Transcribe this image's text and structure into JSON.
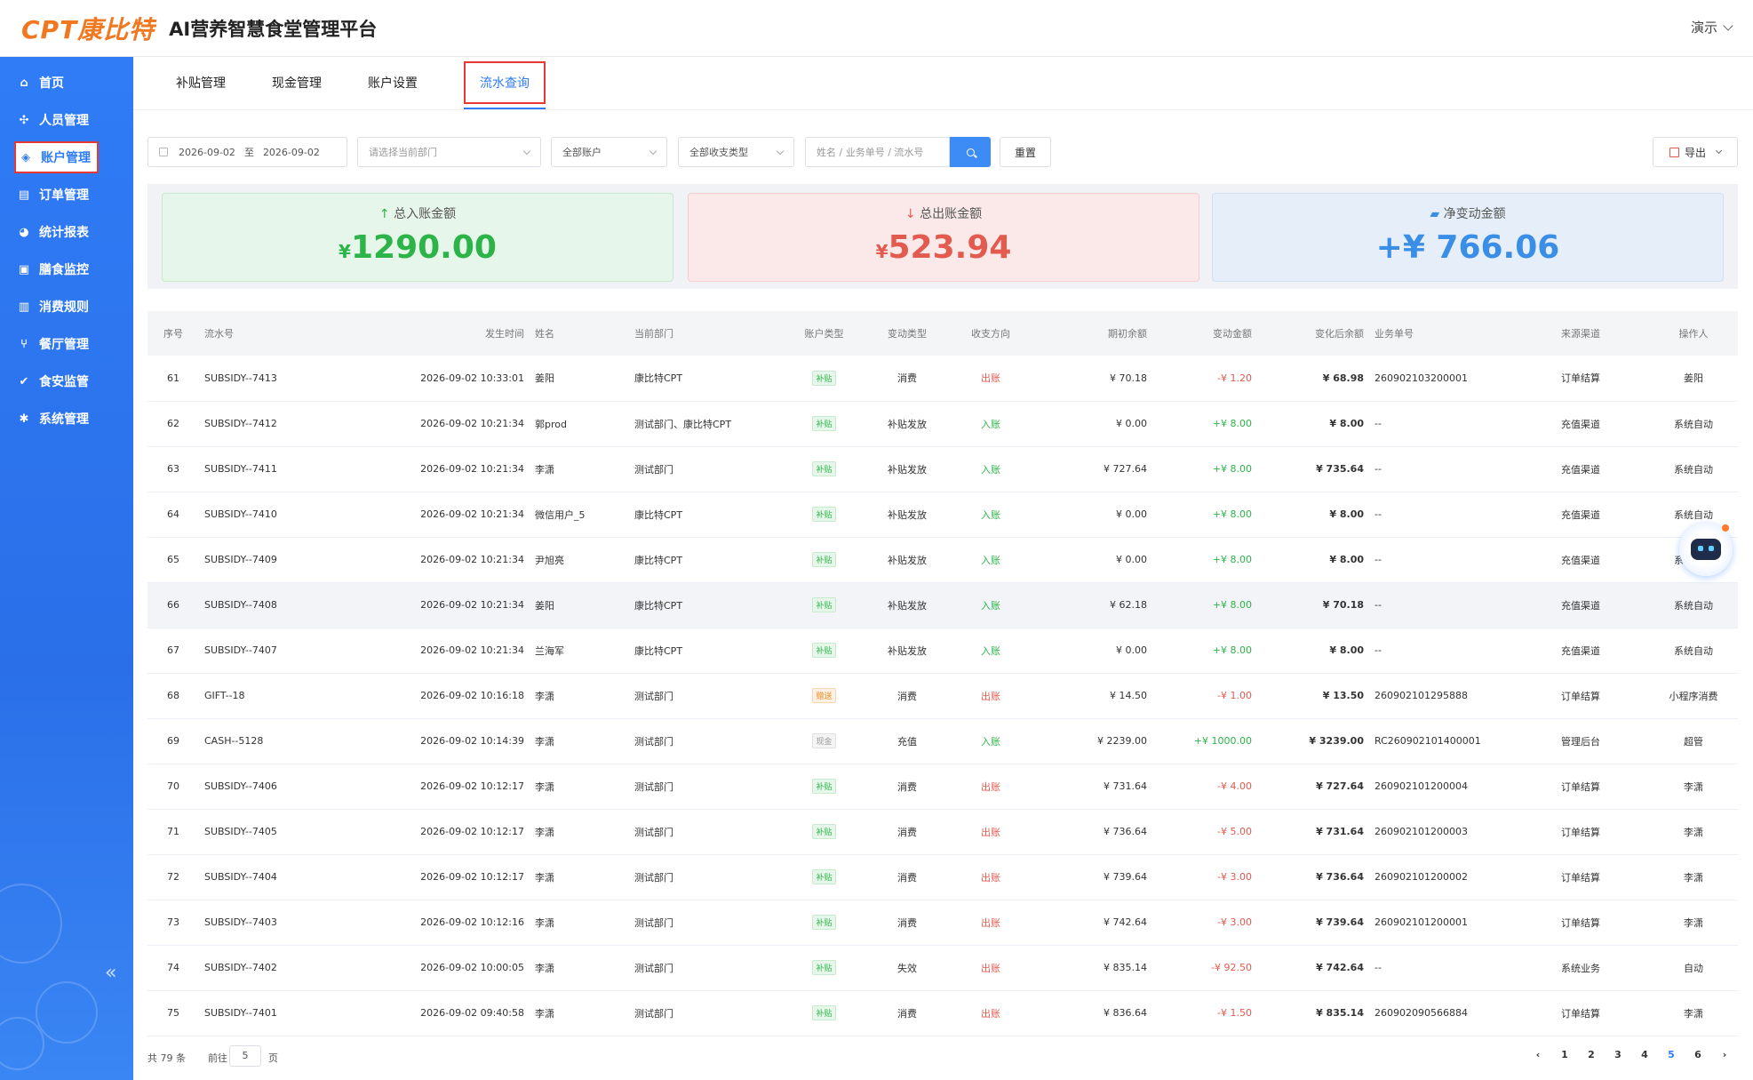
{
  "header": {
    "logo_text": "CPT康比特",
    "title": "AI营养智慧食堂管理平台",
    "user_label": "演示"
  },
  "sidebar": {
    "items": [
      {
        "label": "首页",
        "icon": "home-icon"
      },
      {
        "label": "人员管理",
        "icon": "people-icon"
      },
      {
        "label": "账户管理",
        "icon": "account-icon",
        "active": true
      },
      {
        "label": "订单管理",
        "icon": "order-icon"
      },
      {
        "label": "统计报表",
        "icon": "pie-chart-icon"
      },
      {
        "label": "膳食监控",
        "icon": "monitor-icon"
      },
      {
        "label": "消费规则",
        "icon": "bar-chart-icon"
      },
      {
        "label": "餐厅管理",
        "icon": "fork-knife-icon"
      },
      {
        "label": "食安监管",
        "icon": "check-circle-icon"
      },
      {
        "label": "系统管理",
        "icon": "gear-icon"
      }
    ],
    "collapse_glyph": "«"
  },
  "tabs": [
    {
      "label": "补贴管理"
    },
    {
      "label": "现金管理"
    },
    {
      "label": "账户设置"
    },
    {
      "label": "流水查询",
      "active": true
    }
  ],
  "filters": {
    "date_start": "2026-09-02",
    "date_sep": "至",
    "date_end": "2026-09-02",
    "dept_placeholder": "请选择当前部门",
    "account_value": "全部账户",
    "type_value": "全部收支类型",
    "search_placeholder": "姓名 / 业务单号 / 流水号",
    "reset_label": "重置",
    "export_label": "导出"
  },
  "summary": {
    "in_label": "总入账金额",
    "in_value": "1290.00",
    "out_label": "总出账金额",
    "out_value": "523.94",
    "net_label": "净变动金额",
    "net_value": "+¥ 766.06",
    "currency": "¥"
  },
  "table": {
    "headers": [
      "序号",
      "流水号",
      "发生时间",
      "姓名",
      "当前部门",
      "账户类型",
      "变动类型",
      "收支方向",
      "期初余额",
      "变动金额",
      "变化后余额",
      "业务单号",
      "来源渠道",
      "操作人"
    ],
    "rows": [
      {
        "no": "61",
        "serial": "SUBSIDY--7413",
        "time": "2026-09-02 10:33:01",
        "name": "姜阳",
        "dept": "康比特CPT",
        "acct": "补贴",
        "acct_kind": "subsidy",
        "change": "消费",
        "dir": "出账",
        "dir_kind": "out",
        "open": "¥ 70.18",
        "amt": "-¥ 1.20",
        "after": "¥ 68.98",
        "biz": "260902103200001",
        "channel": "订单结算",
        "op": "姜阳"
      },
      {
        "no": "62",
        "serial": "SUBSIDY--7412",
        "time": "2026-09-02 10:21:34",
        "name": "郭prod",
        "dept": "测试部门、康比特CPT",
        "acct": "补贴",
        "acct_kind": "subsidy",
        "change": "补贴发放",
        "dir": "入账",
        "dir_kind": "in",
        "open": "¥ 0.00",
        "amt": "+¥ 8.00",
        "after": "¥ 8.00",
        "biz": "--",
        "channel": "充值渠道",
        "op": "系统自动"
      },
      {
        "no": "63",
        "serial": "SUBSIDY--7411",
        "time": "2026-09-02 10:21:34",
        "name": "李潇",
        "dept": "测试部门",
        "acct": "补贴",
        "acct_kind": "subsidy",
        "change": "补贴发放",
        "dir": "入账",
        "dir_kind": "in",
        "open": "¥ 727.64",
        "amt": "+¥ 8.00",
        "after": "¥ 735.64",
        "biz": "--",
        "channel": "充值渠道",
        "op": "系统自动"
      },
      {
        "no": "64",
        "serial": "SUBSIDY--7410",
        "time": "2026-09-02 10:21:34",
        "name": "微信用户_5",
        "dept": "康比特CPT",
        "acct": "补贴",
        "acct_kind": "subsidy",
        "change": "补贴发放",
        "dir": "入账",
        "dir_kind": "in",
        "open": "¥ 0.00",
        "amt": "+¥ 8.00",
        "after": "¥ 8.00",
        "biz": "--",
        "channel": "充值渠道",
        "op": "系统自动"
      },
      {
        "no": "65",
        "serial": "SUBSIDY--7409",
        "time": "2026-09-02 10:21:34",
        "name": "尹旭亮",
        "dept": "康比特CPT",
        "acct": "补贴",
        "acct_kind": "subsidy",
        "change": "补贴发放",
        "dir": "入账",
        "dir_kind": "in",
        "open": "¥ 0.00",
        "amt": "+¥ 8.00",
        "after": "¥ 8.00",
        "biz": "--",
        "channel": "充值渠道",
        "op": "系统自动"
      },
      {
        "no": "66",
        "serial": "SUBSIDY--7408",
        "time": "2026-09-02 10:21:34",
        "name": "姜阳",
        "dept": "康比特CPT",
        "acct": "补贴",
        "acct_kind": "subsidy",
        "change": "补贴发放",
        "dir": "入账",
        "dir_kind": "in",
        "open": "¥ 62.18",
        "amt": "+¥ 8.00",
        "after": "¥ 70.18",
        "biz": "--",
        "channel": "充值渠道",
        "op": "系统自动"
      },
      {
        "no": "67",
        "serial": "SUBSIDY--7407",
        "time": "2026-09-02 10:21:34",
        "name": "兰海军",
        "dept": "康比特CPT",
        "acct": "补贴",
        "acct_kind": "subsidy",
        "change": "补贴发放",
        "dir": "入账",
        "dir_kind": "in",
        "open": "¥ 0.00",
        "amt": "+¥ 8.00",
        "after": "¥ 8.00",
        "biz": "--",
        "channel": "充值渠道",
        "op": "系统自动"
      },
      {
        "no": "68",
        "serial": "GIFT--18",
        "time": "2026-09-02 10:16:18",
        "name": "李潇",
        "dept": "测试部门",
        "acct": "赠送",
        "acct_kind": "gift",
        "change": "消费",
        "dir": "出账",
        "dir_kind": "out",
        "open": "¥ 14.50",
        "amt": "-¥ 1.00",
        "after": "¥ 13.50",
        "biz": "260902101295888",
        "channel": "订单结算",
        "op": "小程序消费"
      },
      {
        "no": "69",
        "serial": "CASH--5128",
        "time": "2026-09-02 10:14:39",
        "name": "李潇",
        "dept": "测试部门",
        "acct": "现金",
        "acct_kind": "cash",
        "change": "充值",
        "dir": "入账",
        "dir_kind": "in",
        "open": "¥ 2239.00",
        "amt": "+¥ 1000.00",
        "after": "¥ 3239.00",
        "biz": "RC260902101400001",
        "channel": "管理后台",
        "op": "超管"
      },
      {
        "no": "70",
        "serial": "SUBSIDY--7406",
        "time": "2026-09-02 10:12:17",
        "name": "李潇",
        "dept": "测试部门",
        "acct": "补贴",
        "acct_kind": "subsidy",
        "change": "消费",
        "dir": "出账",
        "dir_kind": "out",
        "open": "¥ 731.64",
        "amt": "-¥ 4.00",
        "after": "¥ 727.64",
        "biz": "260902101200004",
        "channel": "订单结算",
        "op": "李潇"
      },
      {
        "no": "71",
        "serial": "SUBSIDY--7405",
        "time": "2026-09-02 10:12:17",
        "name": "李潇",
        "dept": "测试部门",
        "acct": "补贴",
        "acct_kind": "subsidy",
        "change": "消费",
        "dir": "出账",
        "dir_kind": "out",
        "open": "¥ 736.64",
        "amt": "-¥ 5.00",
        "after": "¥ 731.64",
        "biz": "260902101200003",
        "channel": "订单结算",
        "op": "李潇"
      },
      {
        "no": "72",
        "serial": "SUBSIDY--7404",
        "time": "2026-09-02 10:12:17",
        "name": "李潇",
        "dept": "测试部门",
        "acct": "补贴",
        "acct_kind": "subsidy",
        "change": "消费",
        "dir": "出账",
        "dir_kind": "out",
        "open": "¥ 739.64",
        "amt": "-¥ 3.00",
        "after": "¥ 736.64",
        "biz": "260902101200002",
        "channel": "订单结算",
        "op": "李潇"
      },
      {
        "no": "73",
        "serial": "SUBSIDY--7403",
        "time": "2026-09-02 10:12:16",
        "name": "李潇",
        "dept": "测试部门",
        "acct": "补贴",
        "acct_kind": "subsidy",
        "change": "消费",
        "dir": "出账",
        "dir_kind": "out",
        "open": "¥ 742.64",
        "amt": "-¥ 3.00",
        "after": "¥ 739.64",
        "biz": "260902101200001",
        "channel": "订单结算",
        "op": "李潇"
      },
      {
        "no": "74",
        "serial": "SUBSIDY--7402",
        "time": "2026-09-02 10:00:05",
        "name": "李潇",
        "dept": "测试部门",
        "acct": "补贴",
        "acct_kind": "subsidy",
        "change": "失效",
        "dir": "出账",
        "dir_kind": "out",
        "open": "¥ 835.14",
        "amt": "-¥ 92.50",
        "after": "¥ 742.64",
        "biz": "--",
        "channel": "系统业务",
        "op": "自动"
      },
      {
        "no": "75",
        "serial": "SUBSIDY--7401",
        "time": "2026-09-02 09:40:58",
        "name": "李潇",
        "dept": "测试部门",
        "acct": "补贴",
        "acct_kind": "subsidy",
        "change": "消费",
        "dir": "出账",
        "dir_kind": "out",
        "open": "¥ 836.64",
        "amt": "-¥ 1.50",
        "after": "¥ 835.14",
        "biz": "260902090566884",
        "channel": "订单结算",
        "op": "李潇"
      }
    ]
  },
  "pager": {
    "total": "共 79 条",
    "goto_prefix": "前往",
    "goto_value": "5",
    "goto_suffix": "页",
    "prev": "‹",
    "next": "›",
    "pages": [
      "1",
      "2",
      "3",
      "4",
      "5",
      "6"
    ],
    "current": "5"
  },
  "colors": {
    "brand": "#f07820",
    "primary": "#2f7cf6",
    "in": "#2db449",
    "out": "#e35a4f",
    "highlight_box": "#e53935"
  }
}
